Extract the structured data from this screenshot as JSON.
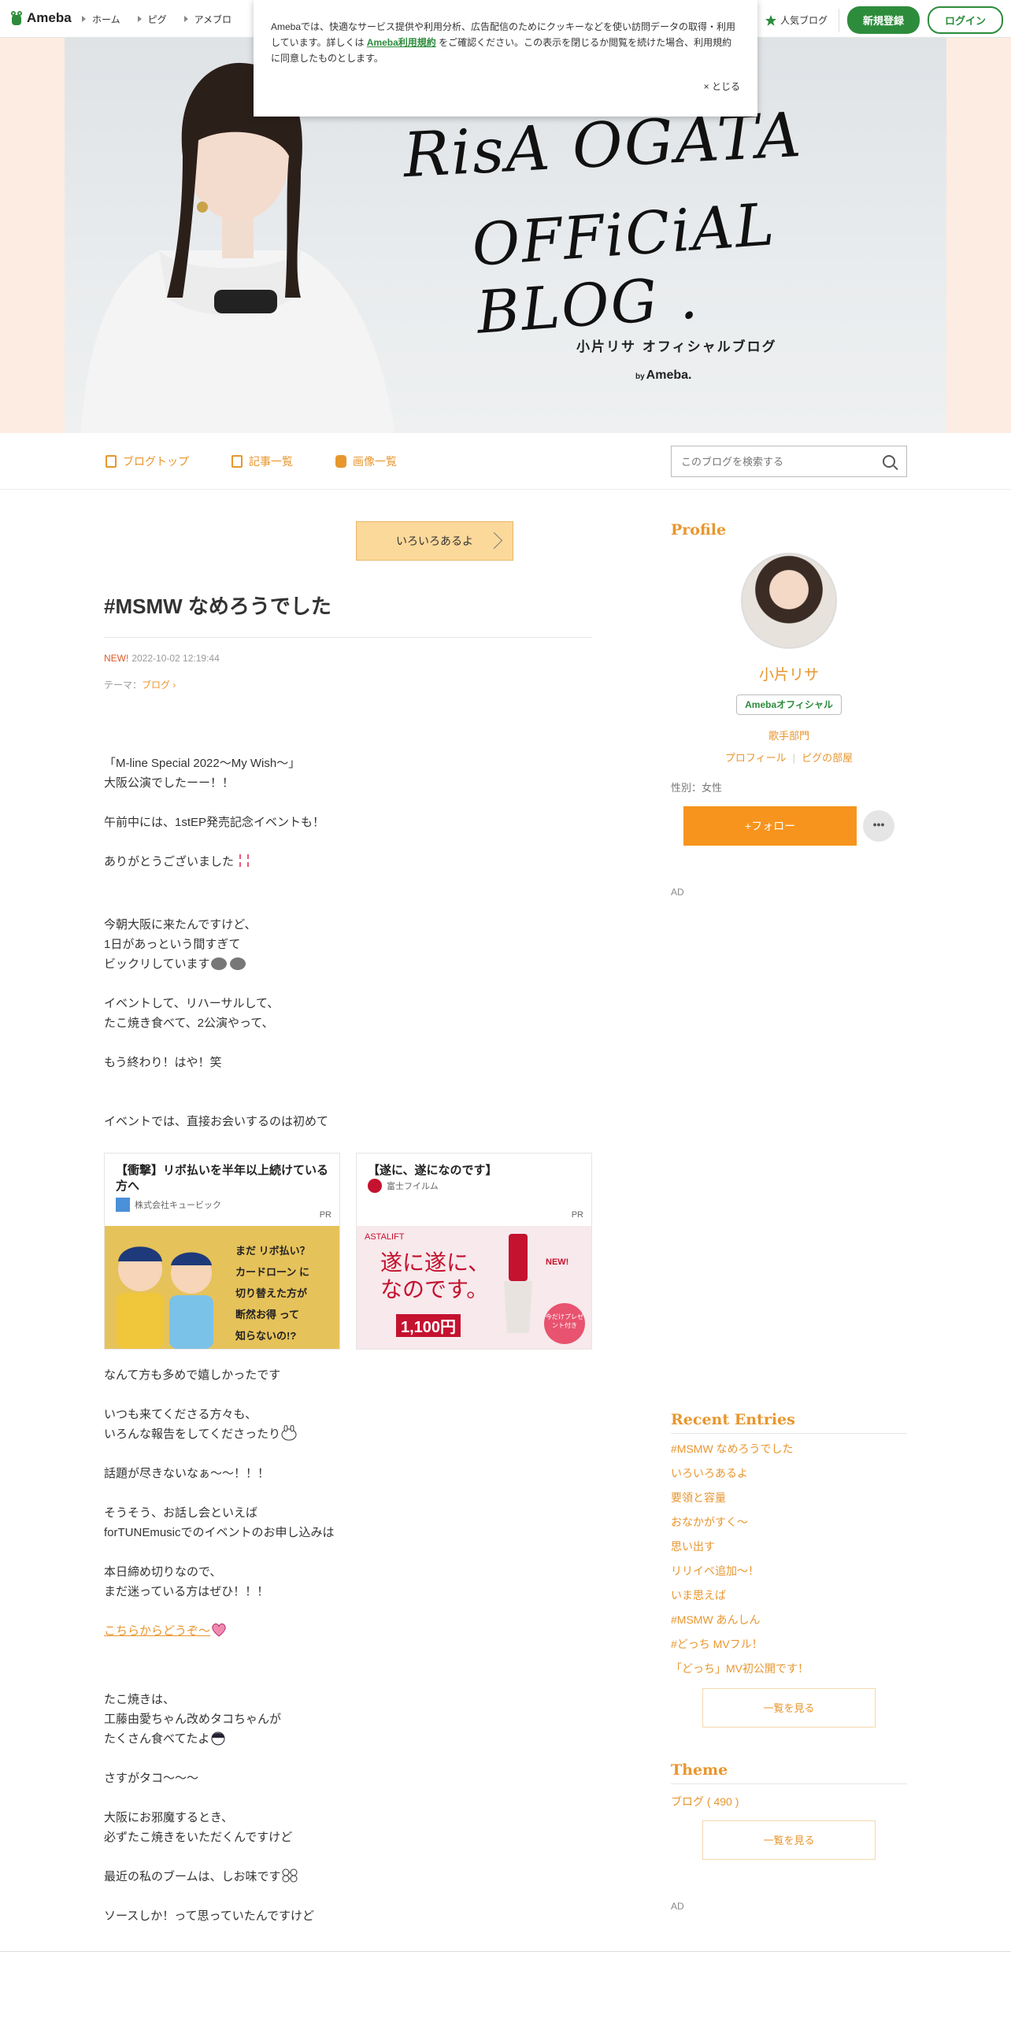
{
  "global_header": {
    "logo": "Ameba",
    "nav": [
      "ホーム",
      "ピグ",
      "アメブロ"
    ],
    "popular": "人気ブログ",
    "signup": "新規登録",
    "login": "ログイン"
  },
  "cookie": {
    "text_before": "Amebaでは、快適なサービス提供や利用分析、広告配信のためにクッキーなどを使い訪問データの取得・利用しています。詳しくは",
    "link": "Ameba利用規約",
    "text_after": "をご確認ください。この表示を閉じるか閲覧を続けた場合、利用規約に同意したものとします。",
    "close": "× とじる"
  },
  "hero": {
    "line1": "RisA OGATA",
    "line2": "OFFiCiAL BLOG .",
    "jp": "小片リサ オフィシャルブログ",
    "by": "by",
    "brand": "Ameba."
  },
  "blog_nav": {
    "top": "ブログトップ",
    "list": "記事一覧",
    "images": "画像一覧",
    "search_placeholder": "このブログを検索する"
  },
  "article": {
    "pr_banner": "いろいろあるよ",
    "title": "#MSMW なめろうでした",
    "new": "NEW!",
    "date": "2022-10-02 12:19:44",
    "theme_label": "テーマ：",
    "theme_value": "ブログ ›",
    "p1": "「M-line Special 2022〜My Wish〜」\n大阪公演でしたーー！！\n\n午前中には、1stEP発売記念イベントも！\n\nありがとうございました",
    "p2": "今朝大阪に来たんですけど、\n1日があっという間すぎて\nビックリしています",
    "p3": "イベントして、リハーサルして、\nたこ焼き食べて、2公演やって、\n\nもう終わり！はや！笑",
    "p4": "イベントでは、直接お会いするのは初めて",
    "ads": [
      {
        "title": "【衝撃】リボ払いを半年以上続けている方へ",
        "sponsor": "株式会社キュービック",
        "pr": "PR",
        "img_lines": [
          "まだ リボ払い？",
          "カードローン に",
          "切り替えた方が",
          "断然お得 って",
          "知らないの!?"
        ]
      },
      {
        "title": "【遂に、遂になのです】",
        "sponsor": "富士フイルム",
        "pr": "PR",
        "img_lines": [
          "ASTALIFT",
          "遂に遂に、",
          "なのです。",
          "NEW!",
          "1,100円",
          "今だけプレゼント付き"
        ]
      }
    ],
    "p5": "なんて方も多めで嬉しかったです\n\nいつも来てくださる方々も、\nいろんな報告をしてくださったり",
    "p6": "話題が尽きないなぁ〜〜！！！\n\nそうそう、お話し会といえば\nforTUNEmusicでのイベントのお申し込みは\n\n本日締め切りなので、\nまだ迷っている方はぜひ！！！",
    "link": "こちらからどうぞ〜",
    "p7": "たこ焼きは、\n工藤由愛ちゃん改めタコちゃんが\nたくさん食べてたよ",
    "p8": "さすがタコ〜〜〜\n\n大阪にお邪魔するとき、\n必ずたこ焼きをいただくんですけど\n\n最近の私のブームは、しお味です",
    "p9": "ソースしか！って思っていたんですけど"
  },
  "sidebar": {
    "profile_head": "Profile",
    "name": "小片リサ",
    "official": "Amebaオフィシャル",
    "category": "歌手部門",
    "profile_link": "プロフィール",
    "pig_link": "ピグの部屋",
    "gender": "性別：女性",
    "follow": "+フォロー",
    "more": "•••",
    "ad": "AD",
    "recent_head": "Recent Entries",
    "recent": [
      "#MSMW なめろうでした",
      "いろいろあるよ",
      "要領と容量",
      "おなかがすく〜",
      "思い出す",
      "リリイベ追加〜！",
      "いま思えば",
      "#MSMW あんしん",
      "#どっち MVフル！",
      "「どっち」MV初公開です！"
    ],
    "see_all": "一覧を見る",
    "theme_head": "Theme",
    "theme_item": "ブログ ( 490 )",
    "see_all2": "一覧を見る",
    "ad2": "AD"
  },
  "colors": {
    "accent": "#e8962e",
    "brand_green": "#2d8c3c",
    "follow": "#f7941d",
    "hero_bg": "#fdece1"
  }
}
